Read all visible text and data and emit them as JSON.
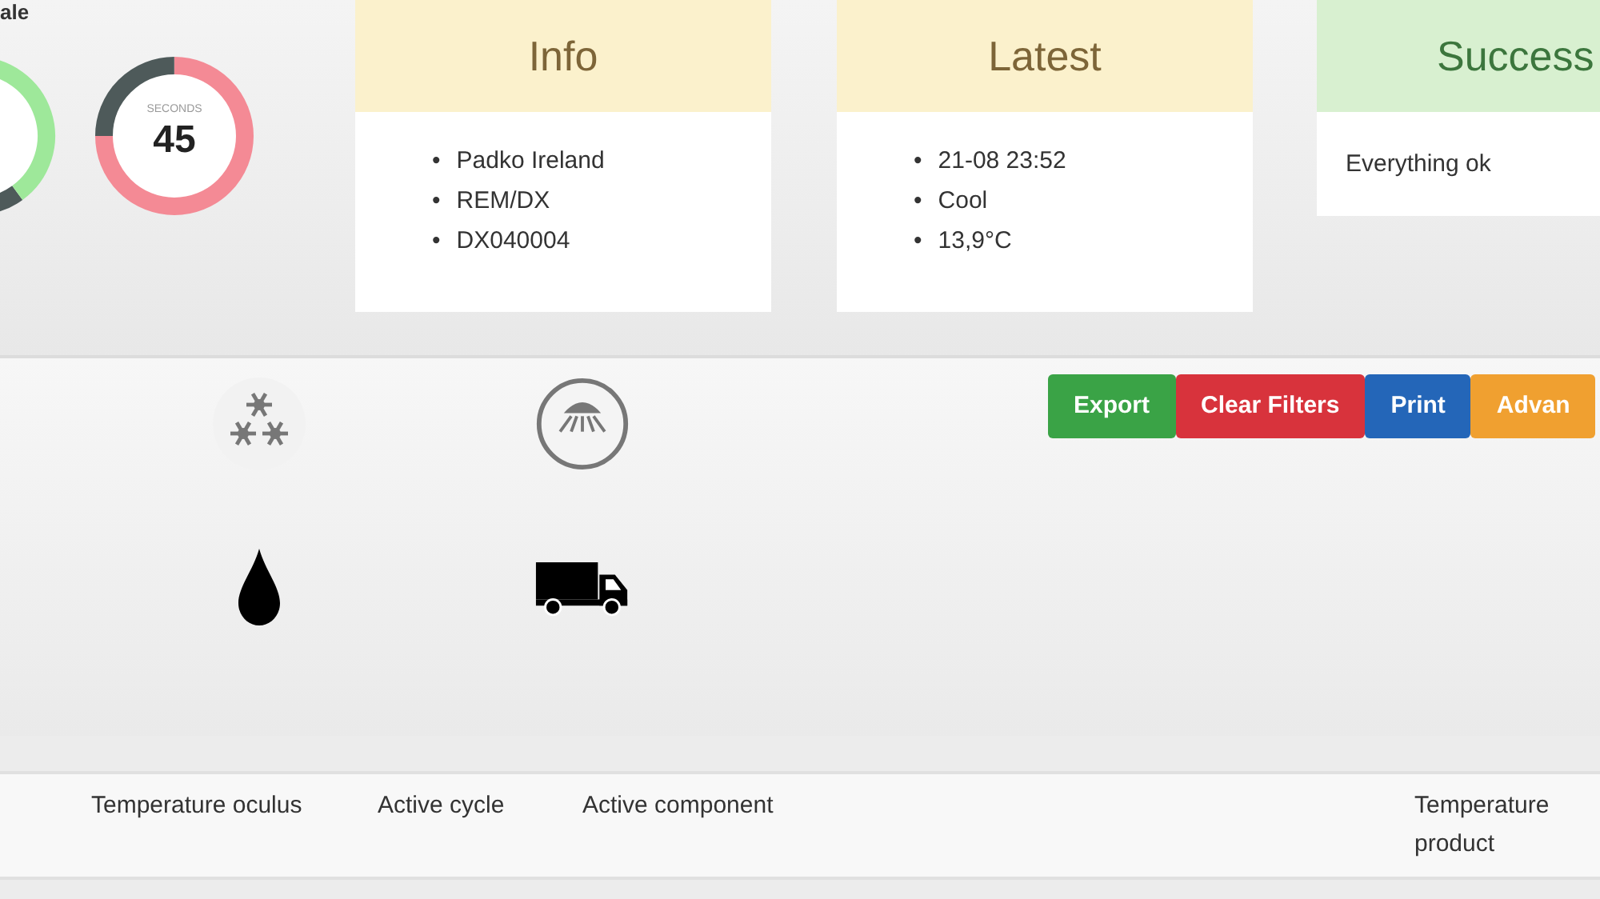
{
  "heading_fragment": "ale",
  "gauges": [
    {
      "color": "#9ee89a"
    },
    {
      "label": "SECONDS",
      "value": "45",
      "color": "#f48a95"
    }
  ],
  "panels": [
    {
      "title": "Info",
      "kind": "list",
      "bullet": "•",
      "items": [
        "Padko Ireland",
        "REM/DX",
        "DX040004"
      ]
    },
    {
      "title": "Latest",
      "kind": "list",
      "bullet": "•",
      "items": [
        "21-08 23:52",
        "Cool",
        "13,9°C"
      ]
    },
    {
      "title": "Success",
      "kind": "text",
      "text": "Everything ok"
    }
  ],
  "status_icons": [
    {
      "kind": "snowflakes"
    },
    {
      "kind": "shower"
    },
    {
      "kind": "drop"
    },
    {
      "kind": "truck"
    }
  ],
  "buttons": [
    {
      "label": "Export"
    },
    {
      "label": "Clear Filters"
    },
    {
      "label": "Print"
    },
    {
      "label": "Advan"
    }
  ],
  "table": {
    "columns": [
      "",
      "Temperature oculus",
      "Active cycle",
      "Active component",
      "Temperature product"
    ]
  }
}
